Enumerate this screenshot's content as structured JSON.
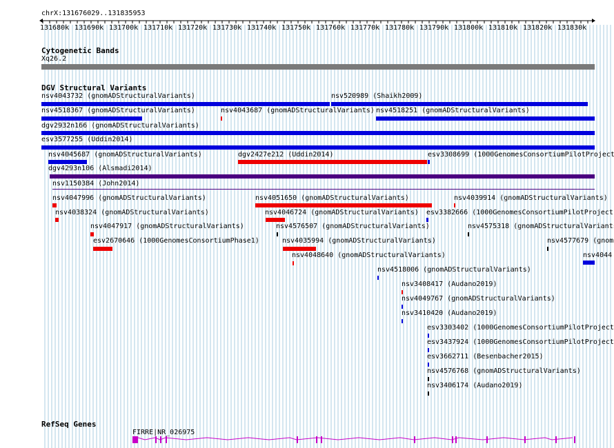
{
  "ruler": {
    "location": "chrX:131676029..131835953",
    "ticks": [
      "131680k",
      "131690k",
      "131700k",
      "131710k",
      "131720k",
      "131730k",
      "131740k",
      "131750k",
      "131760k",
      "131770k",
      "131780k",
      "131790k",
      "131800k",
      "131810k",
      "131820k",
      "131830k"
    ]
  },
  "sections": {
    "cytobands": "Cytogenetic Bands",
    "cytoband_label": "Xq26.2",
    "dgv": "DGV Structural Variants",
    "refseq": "RefSeq Genes"
  },
  "colors": {
    "gain": "#0000dd",
    "loss": "#ee0000",
    "complex": "#000000",
    "inversion": "#4b0080",
    "gene": "#c800c8",
    "grid": "#a8cce0"
  },
  "variants": [
    {
      "label": "nsv4043732 (gnomADStructuralVariants)",
      "type": "gain"
    },
    {
      "label": "nsv520989 (Shaikh2009)",
      "type": "gain"
    },
    {
      "label": "nsv4518367 (gnomADStructuralVariants)",
      "type": "gain"
    },
    {
      "label": "nsv4043687 (gnomADStructuralVariants)",
      "type": "loss"
    },
    {
      "label": "nsv4518251 (gnomADStructuralVariants)",
      "type": "gain"
    },
    {
      "label": "dgv2932n166 (gnomADStructuralVariants)",
      "type": "gain"
    },
    {
      "label": "esv3577255 (Uddin2014)",
      "type": "gain"
    },
    {
      "label": "nsv4045687 (gnomADStructuralVariants)",
      "type": "gain"
    },
    {
      "label": "dgv2427e212 (Uddin2014)",
      "type": "loss"
    },
    {
      "label": "esv3308699 (1000GenomesConsortiumPilotProject",
      "type": "gain"
    },
    {
      "label": "dgv4293n106 (Alsmadi2014)",
      "type": "inversion"
    },
    {
      "label": "nsv1150384 (John2014)",
      "type": "inversion"
    },
    {
      "label": "nsv4047996 (gnomADStructuralVariants)",
      "type": "loss"
    },
    {
      "label": "nsv4051650 (gnomADStructuralVariants)",
      "type": "loss"
    },
    {
      "label": "nsv4039914 (gnomADStructuralVariants)",
      "type": "loss"
    },
    {
      "label": "nsv4038324 (gnomADStructuralVariants)",
      "type": "loss"
    },
    {
      "label": "nsv4046724 (gnomADStructuralVariants)",
      "type": "loss"
    },
    {
      "label": "esv3382666 (1000GenomesConsortiumPilotProject",
      "type": "gain"
    },
    {
      "label": "nsv4047917 (gnomADStructuralVariants)",
      "type": "loss"
    },
    {
      "label": "nsv4576507 (gnomADStructuralVariants)",
      "type": "complex"
    },
    {
      "label": "nsv4575318 (gnomADStructuralVariants",
      "type": "complex"
    },
    {
      "label": "esv2670646 (1000GenomesConsortiumPhase1)",
      "type": "loss"
    },
    {
      "label": "nsv4035994 (gnomADStructuralVariants)",
      "type": "loss"
    },
    {
      "label": "nsv4577679 (gnom",
      "type": "complex"
    },
    {
      "label": "nsv4044",
      "type": "gain"
    },
    {
      "label": "nsv4048640 (gnomADStructuralVariants)",
      "type": "loss"
    },
    {
      "label": "nsv4518006 (gnomADStructuralVariants)",
      "type": "gain"
    },
    {
      "label": "nsv3408417 (Audano2019)",
      "type": "loss"
    },
    {
      "label": "nsv4049767 (gnomADStructuralVariants)",
      "type": "gain"
    },
    {
      "label": "nsv3410420 (Audano2019)",
      "type": "gain"
    },
    {
      "label": "esv3303402 (1000GenomesConsortiumPilotProject",
      "type": "gain"
    },
    {
      "label": "esv3437924 (1000GenomesConsortiumPilotProject",
      "type": "gain"
    },
    {
      "label": "esv3662711 (Besenbacher2015)",
      "type": "gain"
    },
    {
      "label": "nsv4576768 (gnomADStructuralVariants)",
      "type": "complex"
    },
    {
      "label": "nsv3406174 (Audano2019)",
      "type": "complex"
    }
  ],
  "gene": {
    "label": "FIRRE|NR_026975"
  }
}
